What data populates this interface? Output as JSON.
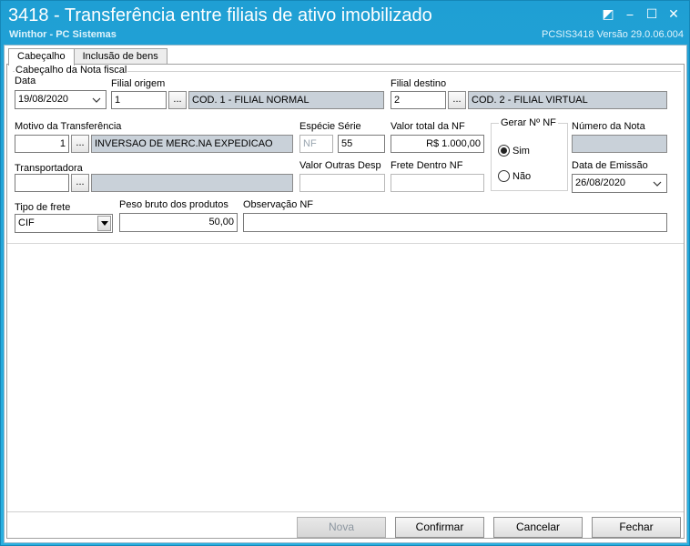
{
  "window": {
    "title": "3418 - Transferência entre filiais de ativo imobilizado",
    "subtitle": "Winthor - PC Sistemas",
    "version": "PCSIS3418  Versão  29.0.06.004",
    "controls": [
      "◩",
      "⎯",
      "☐",
      "✕"
    ]
  },
  "tabs": [
    {
      "label": "Cabeçalho"
    },
    {
      "label": "Inclusão de bens"
    }
  ],
  "form": {
    "group_title": "Cabeçalho da Nota fiscal",
    "data": {
      "label": "Data",
      "value": "19/08/2020"
    },
    "filial_origem": {
      "label": "Filial origem",
      "code": "1",
      "desc": "COD. 1 - FILIAL NORMAL"
    },
    "filial_destino": {
      "label": "Filial destino",
      "code": "2",
      "desc": "COD. 2 - FILIAL VIRTUAL"
    },
    "motivo": {
      "label": "Motivo da Transferência",
      "code": "1",
      "desc": "INVERSAO DE MERC.NA EXPEDICAO"
    },
    "especie": {
      "label": "Espécie",
      "value": "NF"
    },
    "serie": {
      "label": "Série",
      "value": "55"
    },
    "valor_total": {
      "label": "Valor total da NF",
      "value": "R$ 1.000,00"
    },
    "gerar_nf": {
      "label": "Gerar Nº NF",
      "options": [
        "Sim",
        "Não"
      ],
      "selected": "Sim"
    },
    "numero_nota": {
      "label": "Número da Nota",
      "value": ""
    },
    "transportadora": {
      "label": "Transportadora",
      "code": "",
      "desc": ""
    },
    "valor_outras": {
      "label": "Valor Outras Desp",
      "value": ""
    },
    "frete_dentro": {
      "label": "Frete Dentro NF",
      "value": ""
    },
    "data_emissao": {
      "label": "Data de Emissão",
      "value": "26/08/2020"
    },
    "tipo_frete": {
      "label": "Tipo de frete",
      "value": "CIF"
    },
    "peso_bruto": {
      "label": "Peso bruto dos produtos",
      "value": "50,00"
    },
    "observacao": {
      "label": "Observação NF",
      "value": ""
    },
    "ellipsis": "..."
  },
  "buttons": {
    "nova": "Nova",
    "confirmar": "Confirmar",
    "cancelar": "Cancelar",
    "fechar": "Fechar"
  }
}
